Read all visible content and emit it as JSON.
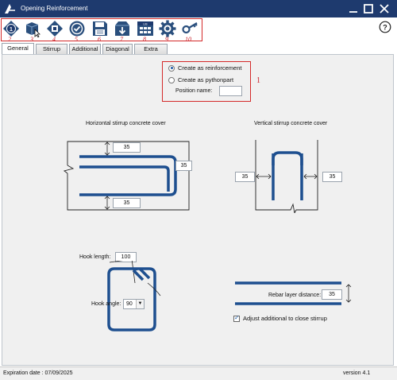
{
  "window": {
    "title": "Opening Reinforcement",
    "logo_icon": "allplan-logo-icon",
    "controls": [
      "minimize-icon",
      "maximize-icon",
      "close-icon"
    ]
  },
  "toolbar": {
    "tools": [
      {
        "icon": "number-one-icon",
        "num": "2"
      },
      {
        "icon": "cube-select-icon",
        "num": "3"
      },
      {
        "icon": "move-diamond-icon",
        "num": "4"
      },
      {
        "icon": "check-circle-icon",
        "num": "5"
      },
      {
        "icon": "save-icon",
        "num": "6"
      },
      {
        "icon": "load-icon",
        "num": "7"
      },
      {
        "icon": "library-icon",
        "num": "8"
      },
      {
        "icon": "settings-gear-icon",
        "num": "9"
      },
      {
        "icon": "key-icon",
        "num": "10"
      }
    ],
    "help_icon": "help-icon"
  },
  "tabs": [
    "General",
    "Stirrup",
    "Additional",
    "Diagonal",
    "Extra Stirrup"
  ],
  "active_tab": "General",
  "creation": {
    "option1": "Create as reinforcement",
    "option2": "Create as pythonpart",
    "position_label": "Position name:",
    "position_value": "",
    "marker": "1"
  },
  "horizontal": {
    "title": "Horizontal stirrup concrete cover",
    "top": "35",
    "right": "35",
    "bottom": "35"
  },
  "vertical": {
    "title": "Vertical stirrup concrete cover",
    "left": "35",
    "right": "35"
  },
  "hook": {
    "length_label": "Hook length:",
    "length_value": "100",
    "angle_label": "Hook angle:",
    "angle_value": "90"
  },
  "rebar": {
    "layer_label": "Rebar layer distance:",
    "layer_value": "35",
    "adjust_label": "Adjust additional to close stirrup",
    "adjust_checked": true
  },
  "colors": {
    "titlebar": "#1e3a6e",
    "rebar": "#1e4f8f",
    "marker_red": "#d42a2a"
  },
  "status": {
    "expiration": "Expiration date : 07/09/2025",
    "version": "version 4.1"
  }
}
